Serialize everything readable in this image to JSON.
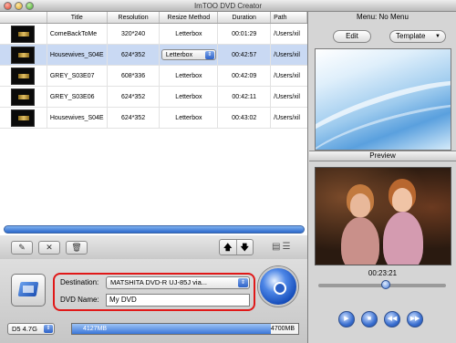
{
  "window": {
    "title": "ImTOO DVD Creator"
  },
  "table": {
    "headers": {
      "thumb": "",
      "title": "Title",
      "resolution": "Resolution",
      "resize": "Resize Method",
      "duration": "Duration",
      "path": "Path"
    },
    "rows": [
      {
        "title": "ComeBackToMe",
        "resolution": "320*240",
        "resize": "Letterbox",
        "duration": "00:01:29",
        "path": "/Users/xil",
        "selected": false
      },
      {
        "title": "Housewives_S04E",
        "resolution": "624*352",
        "resize": "Letterbox",
        "duration": "00:42:57",
        "path": "/Users/xil",
        "selected": true
      },
      {
        "title": "GREY_S03E07",
        "resolution": "608*336",
        "resize": "Letterbox",
        "duration": "00:42:09",
        "path": "/Users/xil",
        "selected": false
      },
      {
        "title": "GREY_S03E06",
        "resolution": "624*352",
        "resize": "Letterbox",
        "duration": "00:42:11",
        "path": "/Users/xil",
        "selected": false
      },
      {
        "title": "Housewives_S04E",
        "resolution": "624*352",
        "resize": "Letterbox",
        "duration": "00:43:02",
        "path": "/Users/xil",
        "selected": false
      }
    ]
  },
  "toolbar": {
    "edit_icon": "edit-icon",
    "delete_icon": "delete-icon",
    "trash_icon": "trash-icon",
    "up_icon": "arrow-up-icon",
    "down_icon": "arrow-down-icon"
  },
  "output": {
    "destination_label": "Destination:",
    "destination_value": "MATSHITA DVD-R   UJ-85J via...",
    "dvd_name_label": "DVD Name:",
    "dvd_name_value": "My DVD",
    "disc_type": "D5 4.7G",
    "used_capacity": "4127MB",
    "total_capacity": "4700MB",
    "used_fraction": 0.878
  },
  "menu": {
    "header": "Menu:  No Menu",
    "edit_label": "Edit",
    "template_label": "Template"
  },
  "preview": {
    "header": "Preview",
    "timecode": "00:23:21",
    "seek_fraction": 0.53
  },
  "colors": {
    "accent": "#2c69cd",
    "highlight_box": "#e01818",
    "selected_row": "#c9d9f3"
  }
}
